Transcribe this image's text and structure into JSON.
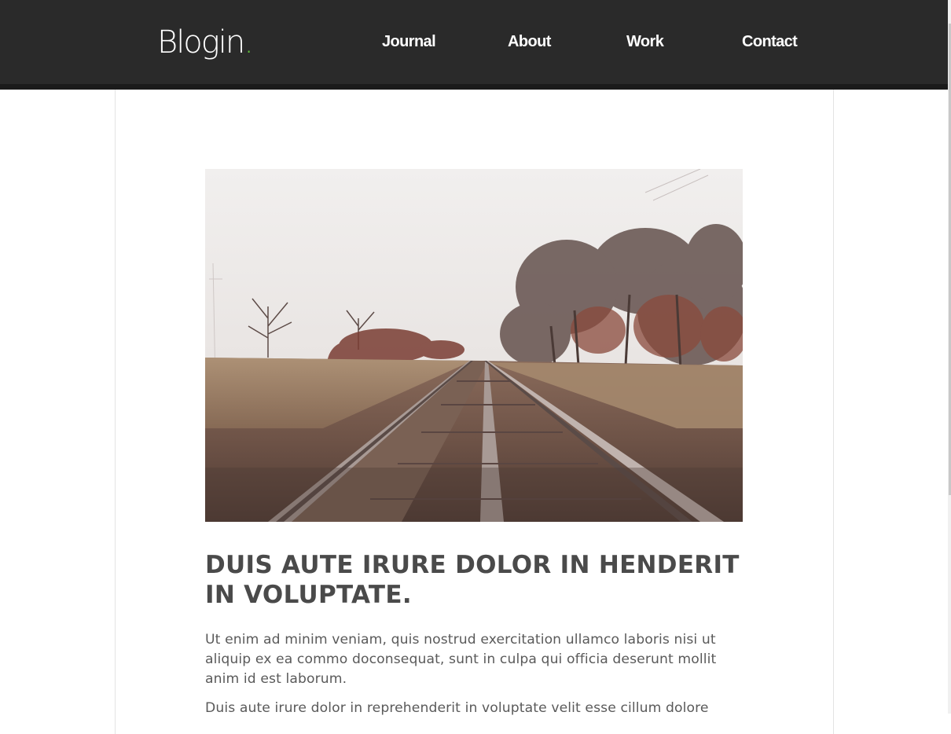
{
  "header": {
    "logo_text": "Blogin",
    "logo_dot": ".",
    "nav": [
      {
        "label": "Journal"
      },
      {
        "label": "About"
      },
      {
        "label": "Work"
      },
      {
        "label": "Contact"
      }
    ]
  },
  "article": {
    "image_subject": "railroad-tracks-photo",
    "title": "DUIS AUTE IRURE DOLOR IN HENDERIT IN VOLUPTATE.",
    "paragraphs": [
      "Ut enim ad minim veniam, quis nostrud exercitation ullamco laboris nisi ut aliquip ex ea commo doconsequat, sunt in culpa qui officia deserunt mollit anim id est laborum.",
      "Duis aute irure dolor in reprehenderit in voluptate velit esse cillum dolore"
    ]
  },
  "colors": {
    "header_bg": "#2a2a2a",
    "logo_accent": "#5fbf3a",
    "title_text": "#4a4a4a",
    "body_text": "#5a5a5a"
  }
}
